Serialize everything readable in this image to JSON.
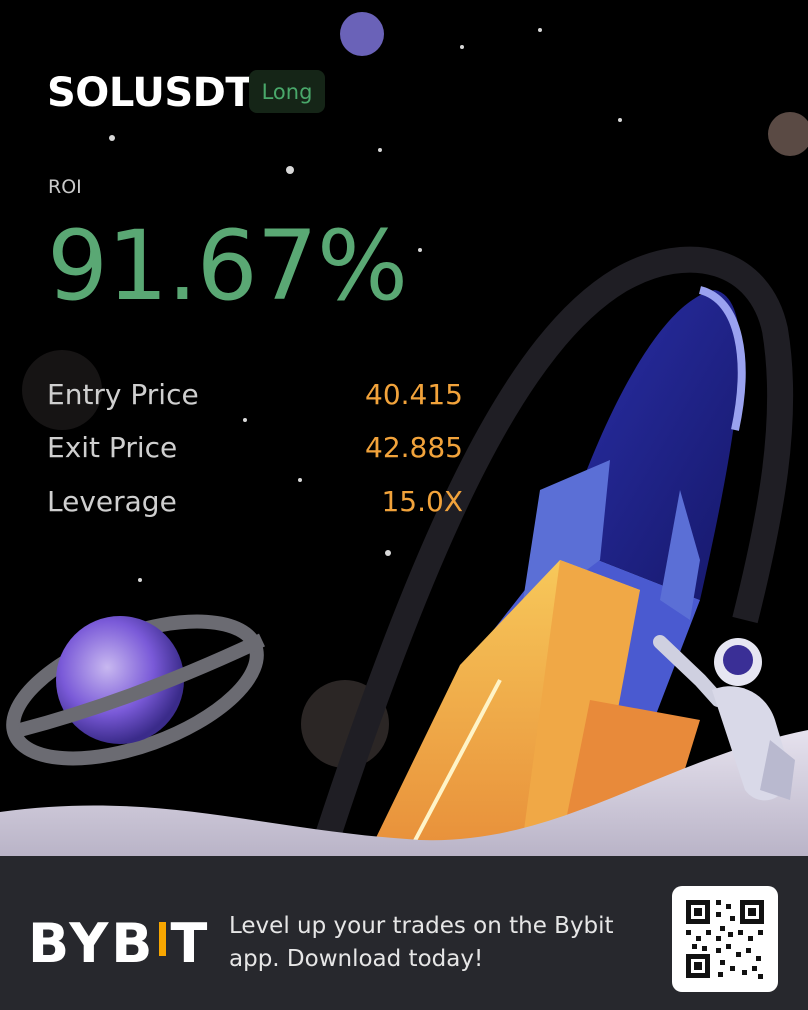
{
  "pair": "SOLUSDT",
  "side": "Long",
  "roi": {
    "label": "ROI",
    "value": "91.67%"
  },
  "stats": [
    {
      "label": "Entry Price",
      "value": "40.415"
    },
    {
      "label": "Exit Price",
      "value": "42.885"
    },
    {
      "label": "Leverage",
      "value": "15.0X"
    }
  ],
  "footer": {
    "logo_left": "BYB",
    "logo_right": "T",
    "promo": "Level up your trades on the Bybit app. Download today!"
  },
  "colors": {
    "profit_green": "#5aa874",
    "value_orange": "#f2a33b",
    "brand_orange": "#f7a600",
    "footer_bg": "#27282d"
  },
  "icons": [
    "qr-code-icon",
    "rocket-illustration",
    "planet-illustration",
    "astronaut-illustration"
  ]
}
